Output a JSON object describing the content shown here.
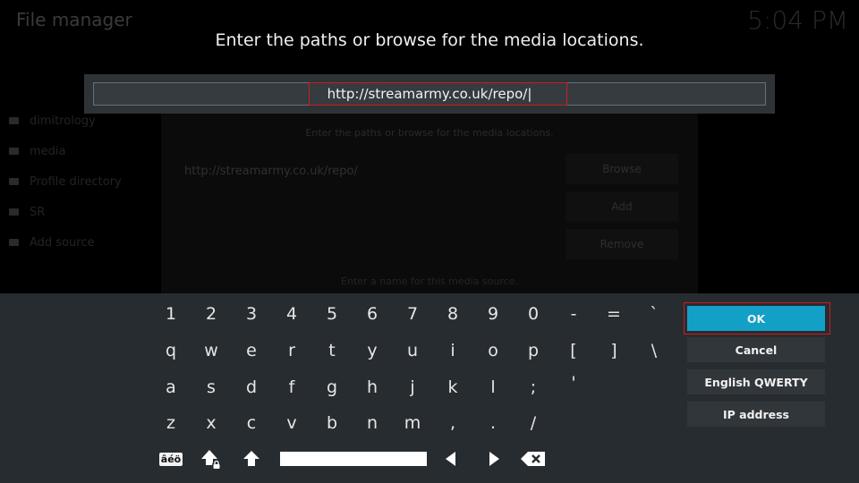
{
  "background": {
    "title": "File manager",
    "clock": "5:04 PM",
    "sidebar": [
      "dimitrology",
      "media",
      "Profile directory",
      "SR",
      "Add source"
    ],
    "dialog": {
      "hint": "Enter the paths or browse for the media locations.",
      "path": "http://streamarmy.co.uk/repo/",
      "buttons": [
        "Browse",
        "Add",
        "Remove"
      ],
      "name_hint": "Enter a name for this media source."
    }
  },
  "prompt": "Enter the paths or browse for the media locations.",
  "input": {
    "value": "http://streamarmy.co.uk/repo/|"
  },
  "keyboard": {
    "rows": [
      [
        "1",
        "2",
        "3",
        "4",
        "5",
        "6",
        "7",
        "8",
        "9",
        "0",
        "-",
        "=",
        "`"
      ],
      [
        "q",
        "w",
        "e",
        "r",
        "t",
        "y",
        "u",
        "i",
        "o",
        "p",
        "[",
        "]",
        "\\"
      ],
      [
        "a",
        "s",
        "d",
        "f",
        "g",
        "h",
        "j",
        "k",
        "l",
        ";",
        "'"
      ],
      [
        "z",
        "x",
        "c",
        "v",
        "b",
        "n",
        "m",
        ",",
        ".",
        "/"
      ]
    ],
    "symbols_label": "âéö",
    "icons": [
      "caps-lock-icon",
      "shift-icon",
      "space-bar",
      "arrow-left-icon",
      "arrow-right-icon",
      "backspace-icon"
    ]
  },
  "actions": {
    "ok": "OK",
    "cancel": "Cancel",
    "layout": "English QWERTY",
    "ip": "IP address"
  },
  "colors": {
    "accent": "#12a0c7",
    "highlight": "#d11a1a",
    "panel": "#272c31"
  }
}
